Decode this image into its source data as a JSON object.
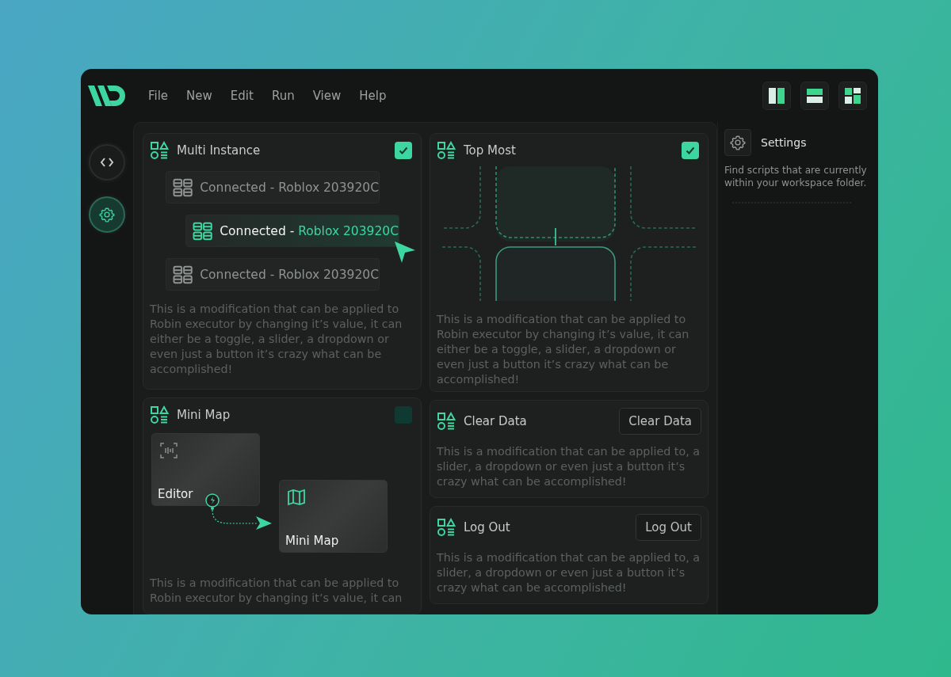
{
  "menu": [
    {
      "label": "File"
    },
    {
      "label": "New"
    },
    {
      "label": "Edit"
    },
    {
      "label": "Run"
    },
    {
      "label": "View"
    },
    {
      "label": "Help"
    }
  ],
  "layout_buttons": [
    {
      "kind": "columns"
    },
    {
      "kind": "rows"
    },
    {
      "kind": "grid"
    }
  ],
  "rail": [
    {
      "kind": "code",
      "selected": false
    },
    {
      "kind": "settings",
      "selected": true
    }
  ],
  "columns": [
    {
      "cards": [
        {
          "kind": "instances",
          "title": "Multi Instance",
          "checked": true,
          "instances": [
            {
              "status": "Connected",
              "separator": "-",
              "name": "Roblox 203920C",
              "selected": false
            },
            {
              "status": "Connected",
              "separator": "-",
              "name": "Roblox 203920C",
              "selected": true
            },
            {
              "status": "Connected",
              "separator": "-",
              "name": "Roblox 203920C",
              "selected": false
            }
          ],
          "description": "This is a modification that can be applied to Robin executor by changing it’s value, it can either be a toggle, a slider, a dropdown or even just a button it’s crazy what can be accomplished!"
        },
        {
          "kind": "flow",
          "title": "Mini Map",
          "checked": false,
          "nodes": [
            {
              "label": "Editor"
            },
            {
              "label": "Mini Map"
            }
          ],
          "description": "This is a modification that can be applied to Robin executor by changing it’s value, it can"
        }
      ]
    },
    {
      "cards": [
        {
          "kind": "diagram",
          "title": "Top Most",
          "checked": true,
          "description": "This is a modification that can be applied to Robin executor by changing it’s value, it can either be a toggle, a slider, a dropdown or even just a button it’s crazy what can be accomplished!"
        },
        {
          "kind": "action",
          "title": "Clear Data",
          "button": "Clear Data",
          "description": "This is a modification that can be applied to, a slider, a dropdown or even just a button it’s crazy what can be accomplished!"
        },
        {
          "kind": "action",
          "title": "Log Out",
          "button": "Log Out",
          "description": "This is a modification that can be applied to, a slider, a dropdown or even just a button it’s crazy what can be accomplished!"
        }
      ]
    }
  ],
  "side_panel": {
    "title": "Settings",
    "text": "Find scripts that are currently within your workspace folder."
  }
}
